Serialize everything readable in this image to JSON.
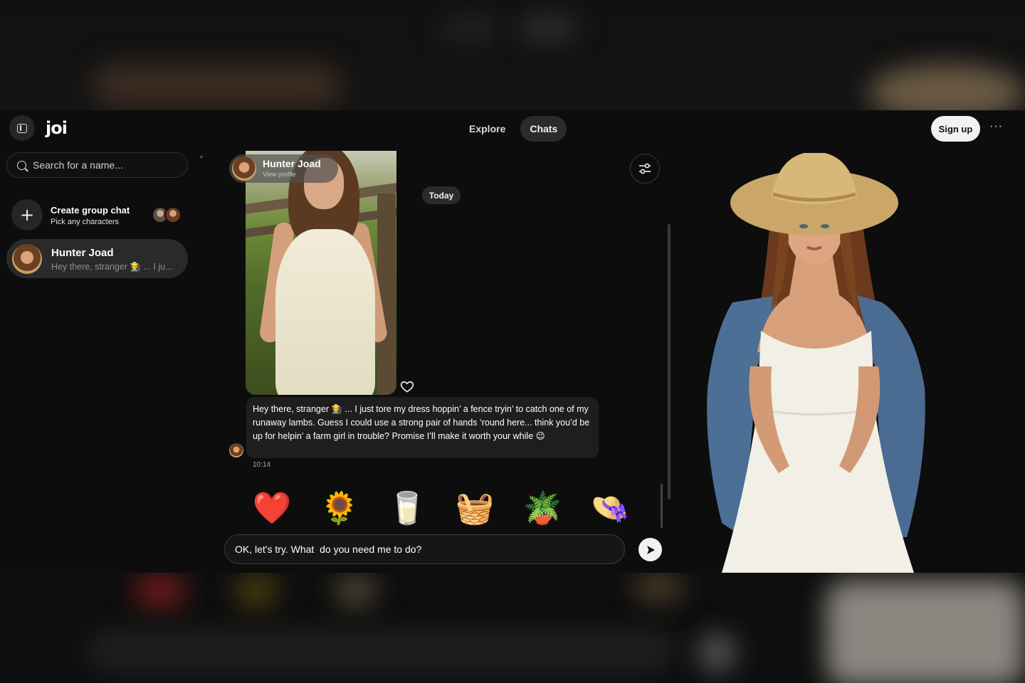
{
  "header": {
    "logo": "joi",
    "nav": [
      {
        "label": "Explore",
        "active": false
      },
      {
        "label": "Chats",
        "active": true
      }
    ],
    "signup_label": "Sign up",
    "more_label": "···"
  },
  "sidebar": {
    "search_placeholder": "Search for a name...",
    "group_chat": {
      "title": "Create group chat",
      "subtitle": "Pick any characters"
    },
    "chats": [
      {
        "name": "Hunter Joad",
        "preview": "Hey there, stranger 👩‍🌾 ... I ju..."
      }
    ]
  },
  "chat": {
    "profile": {
      "name": "Hunter Joad",
      "link": "View profile"
    },
    "date_divider": "Today",
    "message": {
      "text": "Hey there, stranger 👩‍🌾 ... I just tore my dress hoppin’ a fence tryin’ to catch one of my runaway lambs. Guess I could use a strong pair of hands ‘round here... think you’d be up for helpin’ a farm girl in trouble? Promise I’ll make it worth your while 😉",
      "time": "10:14"
    },
    "gifts": [
      "❤️",
      "🌻",
      "🥛",
      "🧺",
      "🪴",
      "👒"
    ],
    "composer_value": "OK, let's try. What  do you need me to do?"
  },
  "colors": {
    "background": "#0d0d0d",
    "bubble": "#1e1e1e",
    "pill": "#2b2b2b",
    "accent_button": "#f2f2f2"
  }
}
